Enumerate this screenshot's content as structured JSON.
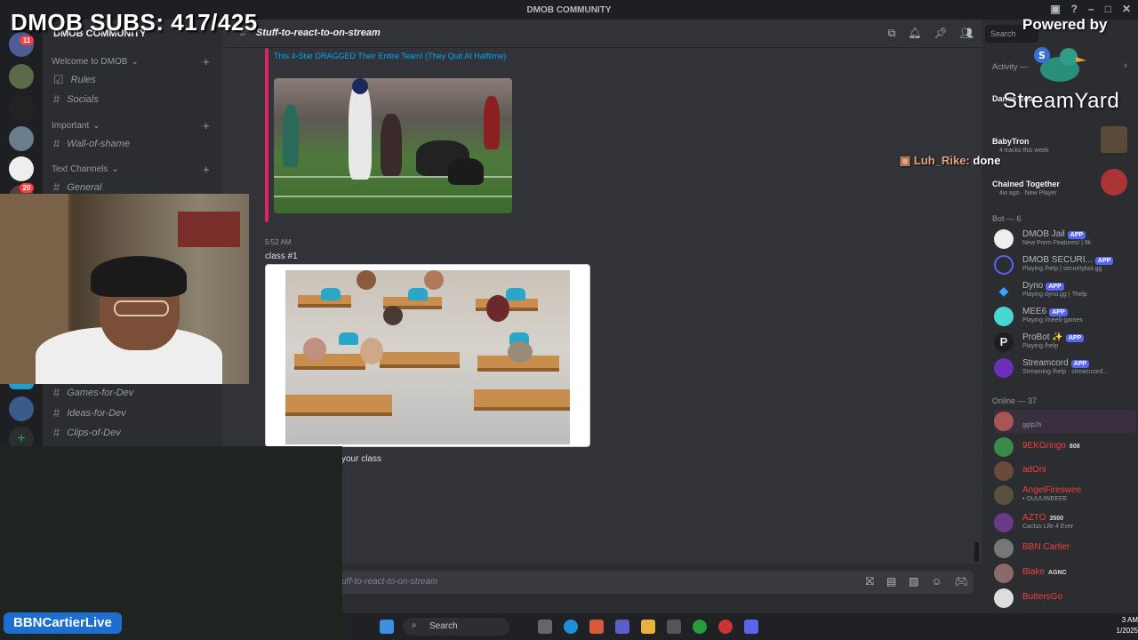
{
  "window": {
    "title": "DMOB COMMUNITY"
  },
  "server": {
    "name": "DMOB COMMUNITY"
  },
  "server_rail": {
    "badges": [
      "11",
      "20"
    ]
  },
  "channels": {
    "categories": [
      {
        "label": "Welcome to DMOB",
        "items": [
          {
            "label": "Rules"
          },
          {
            "label": "Socials"
          }
        ]
      },
      {
        "label": "Important",
        "items": [
          {
            "label": "Wall-of-shame"
          }
        ]
      },
      {
        "label": "Text Channels",
        "items": [
          {
            "label": "General"
          }
        ]
      }
    ],
    "lower_items": [
      {
        "label": "Games-for-Dev"
      },
      {
        "label": "Ideas-for-Dev"
      },
      {
        "label": "Clips-of-Dev"
      }
    ]
  },
  "chat_header": {
    "channel": "Stuff-to-react-to-on-stream"
  },
  "search": {
    "placeholder": "Search"
  },
  "messages": {
    "embed_title": "This 4-Star DRAGGED Their Entire Team! (They Quit At Halftime)",
    "meta": "5:52 AM",
    "text": "class #1",
    "text2": "your class"
  },
  "composer": {
    "placeholder": "uff-to-react-to-on-stream"
  },
  "members": {
    "activity_header": "Activity —",
    "activity": [
      {
        "name": "Dance Soar",
        "sub": "",
        "top": ""
      },
      {
        "name": "BabyTron",
        "sub": "4 tracks this week"
      },
      {
        "name": "Chained Together",
        "sub": "4w ago · New Player"
      }
    ],
    "bot_header": "Bot — 6",
    "bots": [
      {
        "name": "DMOB Jail",
        "status": "New Prem Features! | 9k"
      },
      {
        "name": "DMOB SECURI...",
        "status": "Playing /help | securitybot.gg"
      },
      {
        "name": "Dyno",
        "status": "Playing dyno.gg | ?help"
      },
      {
        "name": "MEE6",
        "status": "Playing /mee6-games"
      },
      {
        "name": "ProBot",
        "status": "Playing /help"
      },
      {
        "name": "Streamcord",
        "status": "Streaming /help · streamcord..."
      }
    ],
    "app_label": "APP",
    "online_header": "Online — 37",
    "online": [
      {
        "name": "",
        "status": "gg/p2h",
        "tag": ""
      },
      {
        "name": "9EKGringo",
        "status": "",
        "tag": "808"
      },
      {
        "name": "adOni",
        "status": "",
        "tag": ""
      },
      {
        "name": "AngelFireswee",
        "status": "• OUUUWEEEE",
        "tag": ""
      },
      {
        "name": "AZTO",
        "status": "Cactus Life 4 Ever",
        "tag": "3500"
      },
      {
        "name": "BBN Cartier",
        "status": "",
        "tag": ""
      },
      {
        "name": "Blake",
        "status": "",
        "tag": "AGNC"
      },
      {
        "name": "ButtersGo",
        "status": "",
        "tag": ""
      }
    ]
  },
  "taskbar": {
    "search": "Search",
    "time": "3 AM",
    "date": "1/2025"
  },
  "overlays": {
    "subs": "DMOB SUBS: 417/425",
    "powered_by": "Powered by",
    "brand": "StreamYard",
    "chat_user": "Luh_Rike:",
    "chat_msg": "done",
    "name_badge": "BBNCartierLive"
  },
  "colors": {
    "accent": "#5865f2",
    "link": "#00a8fc",
    "badge": "#f23f43",
    "embed_bar": "#e0245e"
  }
}
